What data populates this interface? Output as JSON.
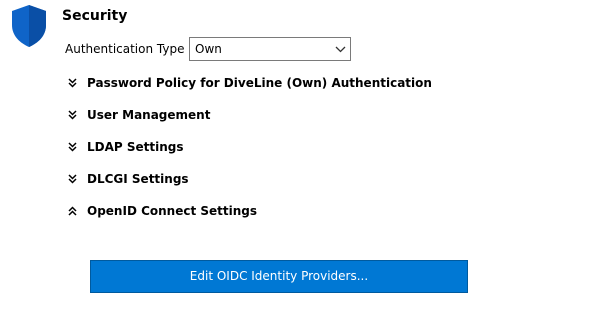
{
  "header": {
    "title": "Security",
    "icon": "shield-icon",
    "icon_color": "#0f64c8"
  },
  "auth": {
    "label": "Authentication Type",
    "selected": "Own"
  },
  "sections": [
    {
      "label": "Password Policy for DiveLine (Own) Authentication",
      "state": "collapsed"
    },
    {
      "label": "User Management",
      "state": "collapsed"
    },
    {
      "label": "LDAP Settings",
      "state": "collapsed"
    },
    {
      "label": "DLCGI Settings",
      "state": "collapsed"
    },
    {
      "label": "OpenID Connect Settings",
      "state": "expanded"
    }
  ],
  "action": {
    "label": "Edit OIDC Identity Providers...",
    "color": "#0078d4"
  }
}
